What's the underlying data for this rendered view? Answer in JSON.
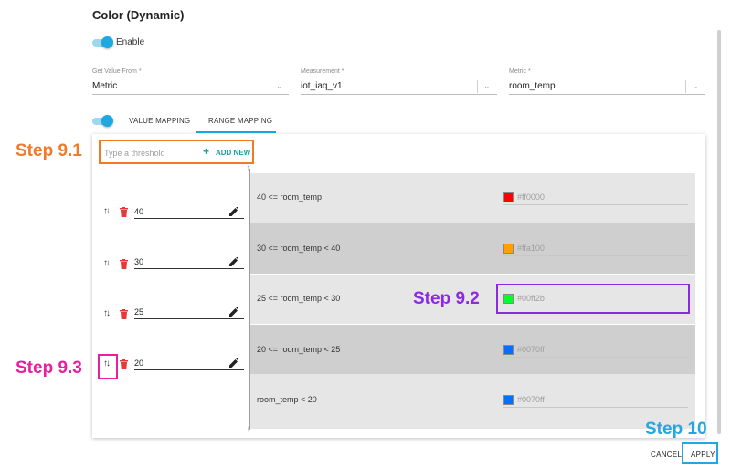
{
  "section_title": "Color (Dynamic)",
  "enable_label": "Enable",
  "get_value_from": {
    "label": "Get Value From *",
    "value": "Metric"
  },
  "measurement": {
    "label": "Measurement *",
    "value": "iot_iaq_v1"
  },
  "metric": {
    "label": "Metric *",
    "value": "room_temp"
  },
  "tabs": {
    "value_mapping": "VALUE MAPPING",
    "range_mapping": "RANGE MAPPING",
    "active": "RANGE MAPPING"
  },
  "threshold_input": {
    "placeholder": "Type a threshold",
    "add_new": "ADD NEW"
  },
  "thresholds": [
    {
      "value": "40"
    },
    {
      "value": "30"
    },
    {
      "value": "25"
    },
    {
      "value": "20"
    }
  ],
  "ranges": [
    {
      "label": "40 <= room_temp",
      "hex": "#ff0000",
      "color": "#ff0000"
    },
    {
      "label": "30 <= room_temp < 40",
      "hex": "#ffa100",
      "color": "#ffa100"
    },
    {
      "label": "25 <= room_temp < 30",
      "hex": "#00ff2b",
      "color": "#00ff2b"
    },
    {
      "label": "20 <= room_temp < 25",
      "hex": "#0070ff",
      "color": "#0070ff"
    },
    {
      "label": "room_temp < 20",
      "hex": "#0070ff",
      "color": "#0070ff"
    }
  ],
  "buttons": {
    "cancel": "CANCEL",
    "apply": "APPLY"
  },
  "annotations": {
    "step_9_1": {
      "label": "Step 9.1",
      "color": "#f07a2a"
    },
    "step_9_2": {
      "label": "Step 9.2",
      "color": "#8a2be2"
    },
    "step_9_3": {
      "label": "Step 9.3",
      "color": "#e81fa0"
    },
    "step_10": {
      "label": "Step 10",
      "color": "#22a8e0"
    }
  },
  "colors": {
    "accent": "#1ea8e0",
    "add_new": "#1aa09a",
    "delete_icon": "#e53935"
  }
}
